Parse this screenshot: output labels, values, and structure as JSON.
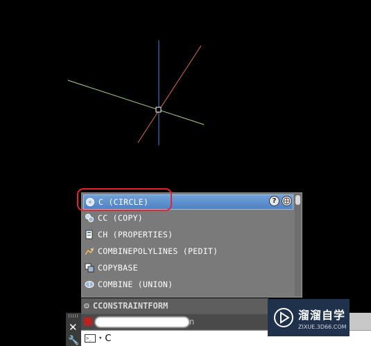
{
  "autocomplete": {
    "items": [
      {
        "label": "C (CIRCLE)",
        "icon": "circle-icon",
        "selected": true
      },
      {
        "label": "CC (COPY)",
        "icon": "copy-icon",
        "selected": false
      },
      {
        "label": "CH (PROPERTIES)",
        "icon": "properties-icon",
        "selected": false
      },
      {
        "label": "COMBINEPOLYLINES (PEDIT)",
        "icon": "pedit-icon",
        "selected": false
      },
      {
        "label": "COPYBASE",
        "icon": "copybase-icon",
        "selected": false
      },
      {
        "label": "COMBINE (UNION)",
        "icon": "union-icon",
        "selected": false
      }
    ],
    "help_label": "?",
    "highlight_color": "#e8242a"
  },
  "history": {
    "row1": "CCONSTRAINTFORM",
    "row2_tail": "n"
  },
  "command": {
    "prompt_icon": ">_",
    "input_value": "C"
  },
  "watermark": {
    "title": "溜溜自学",
    "url": "ZIXUE.3D66.COM"
  },
  "colors": {
    "canvas": "#000000",
    "axis_green": "#a8d08d",
    "axis_blue": "#4a7fd4",
    "axis_orange": "#e0704a"
  }
}
